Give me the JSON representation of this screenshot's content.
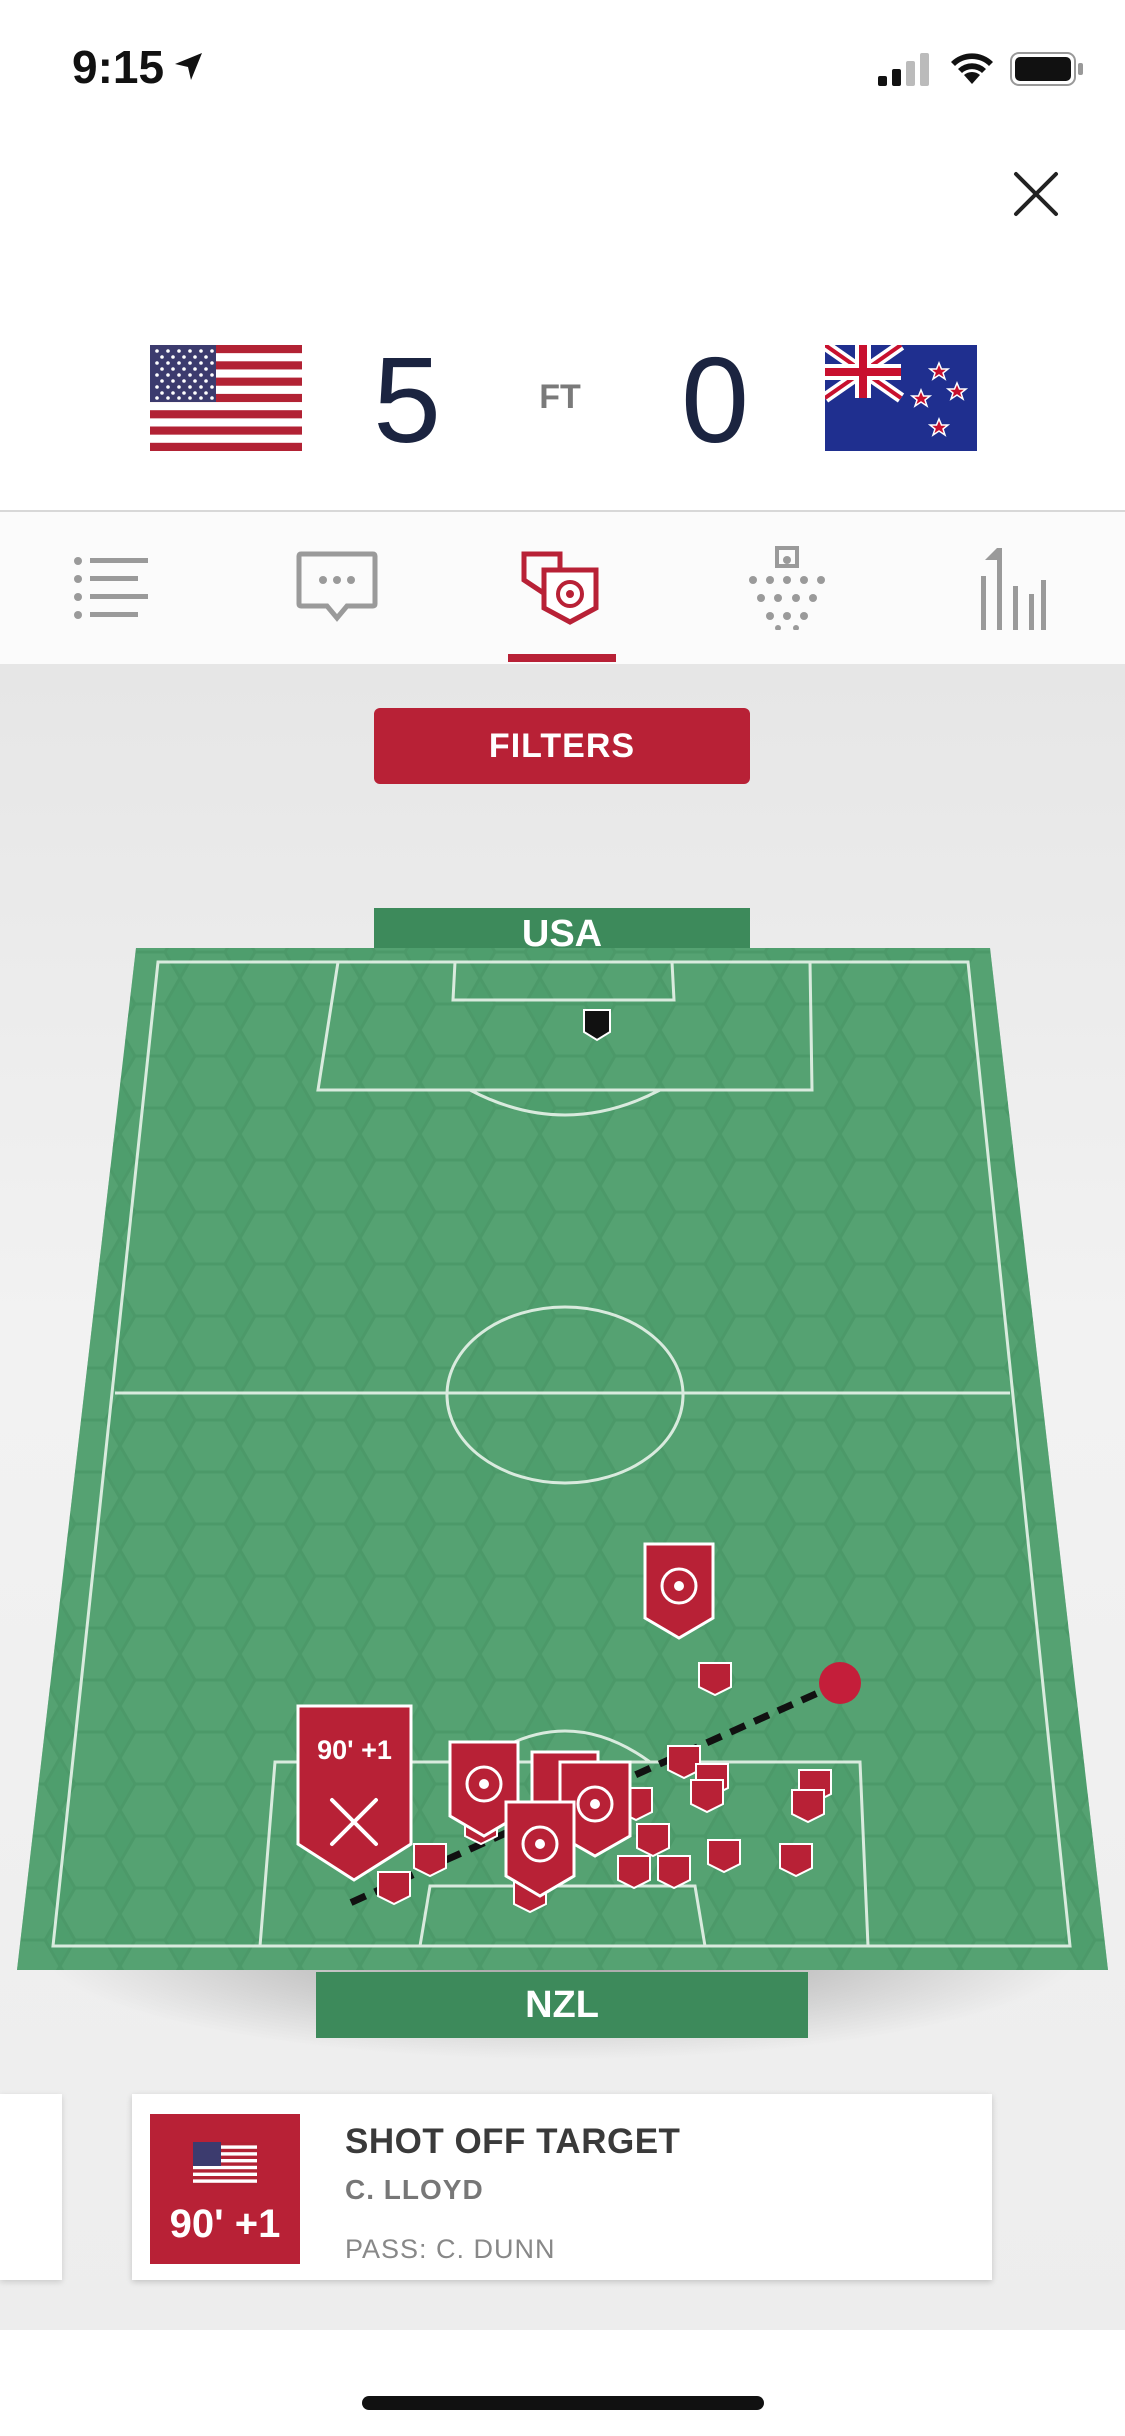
{
  "status_bar": {
    "time": "9:15"
  },
  "match": {
    "home_team": "USA",
    "away_team": "NZL",
    "home_score": "5",
    "away_score": "0",
    "status": "FT"
  },
  "tabs": [
    {
      "name": "tab-summary",
      "icon": "list-icon",
      "active": false
    },
    {
      "name": "tab-commentary",
      "icon": "chat-bubble-icon",
      "active": false
    },
    {
      "name": "tab-shots",
      "icon": "shot-map-icon",
      "active": true
    },
    {
      "name": "tab-lineups",
      "icon": "lineup-grid-icon",
      "active": false
    },
    {
      "name": "tab-stats",
      "icon": "stats-bars-icon",
      "active": false
    }
  ],
  "filters_label": "FILTERS",
  "shot_map": {
    "top_label": "USA",
    "bottom_label": "NZL",
    "highlight_minute": "90' +1"
  },
  "event": {
    "minute": "90' +1",
    "type": "SHOT OFF TARGET",
    "player": "C. LLOYD",
    "assist": "PASS: C. DUNN"
  },
  "colors": {
    "accent": "#b82136",
    "pitch": "#4e9e6d",
    "score": "#1b2440"
  }
}
